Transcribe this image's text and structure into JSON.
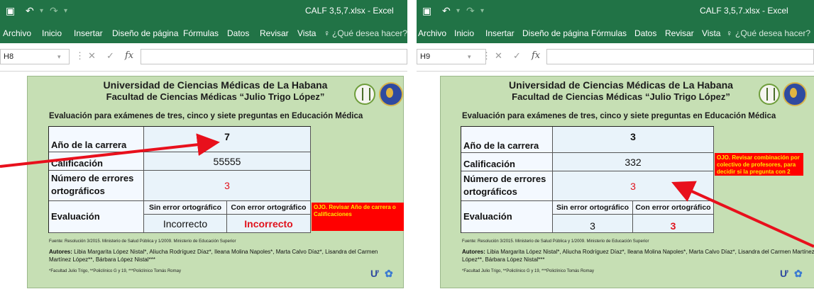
{
  "window_title": "CALF 3,5,7.xlsx - Excel",
  "ribbon_tabs": [
    "Archivo",
    "Inicio",
    "Insertar",
    "Diseño de página",
    "Fórmulas",
    "Datos",
    "Revisar",
    "Vista"
  ],
  "tell_me": "¿Qué desea hacer?",
  "fx_label": "fx",
  "card": {
    "university": "Universidad de Ciencias Médicas de La Habana",
    "faculty": "Facultad de Ciencias Médicas “Julio Trigo López”",
    "subtitle": "Evaluación para exámenes de tres, cinco y siete preguntas en Educación Médica",
    "label_year": "Año de la carrera",
    "label_grade": "Calificación",
    "label_errors": "Número de errores ortográficos",
    "label_eval": "Evaluación",
    "header_without": "Sin error ortográfico",
    "header_with": "Con error ortográfico",
    "source": "Fuente: Resolución 3/2015. Ministerio de Salud Pública y 1/2009. Ministerio de Educación Superior",
    "authors_label": "Autores:",
    "authors": "Libia Margarita López Nistal*, Aliucha Rodríguez Díaz*, Ileana Molina Napoles*, Marta Calvo Díaz*, Lisandra del Carmen Martínez López**, Bárbara López Nistal***",
    "affiliations": "*Facultad Julio Trigo, **Policlínico G y 19, ***Policlínico Tomás Romay"
  },
  "left": {
    "name_box": "H8",
    "year": "7",
    "grade": "55555",
    "errors": "3",
    "eval_without": "Incorrecto",
    "eval_with": "Incorrecto",
    "note": "OJO. Revisar Año de carrera o Calificaciones"
  },
  "right": {
    "name_box": "H9",
    "year": "3",
    "grade": "332",
    "errors": "3",
    "eval_without": "3",
    "eval_with": "3",
    "note": "OJO. Revisar combinación por colectivo de profesores, para decidir si la pregunta con 2"
  },
  "colors": {
    "excel_green": "#217346",
    "card_green": "#c6dfb4",
    "alert_red": "#ff0000",
    "arrow_red": "#e8101c"
  }
}
